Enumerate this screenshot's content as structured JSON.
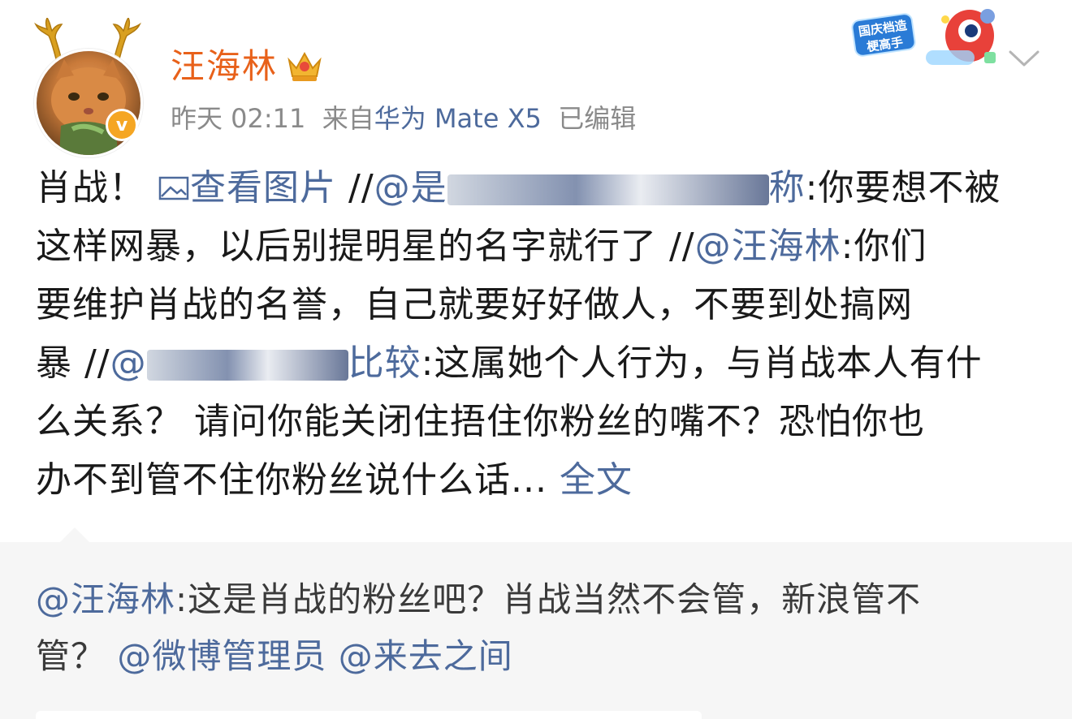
{
  "post": {
    "username": "汪海林",
    "time": "昨天 02:11",
    "source_prefix": "来自",
    "device": "华为 Mate X5",
    "edited": "已编辑",
    "verified_mark": "v",
    "event_badge_text": "国庆档造梗高手",
    "body": {
      "l1_a": "肖战！ ",
      "l1_img": "查看图片",
      "l1_b": " //",
      "l1_mention_start": "@是",
      "l1_mention_end": "称",
      "l1_c": ":你要想不被",
      "l2_a": "这样网暴，以后别提明星的名字就行了 //",
      "l2_mention": "@汪海林",
      "l2_b": ":你们",
      "l3": "要维护肖战的名誉，自己就要好好做人，不要到处搞网",
      "l4_a": "暴 //",
      "l4_mention_start": "@",
      "l4_mention_end": "比较",
      "l4_b": ":这属她个人行为，与肖战本人有什",
      "l5": "么关系？ 请问你能关闭住捂住你粉丝的嘴不？恐怕你也",
      "l6_a": "办不到管不住你粉丝说什么话... ",
      "l6_more": "全文"
    }
  },
  "repost": {
    "mention": "@汪海林",
    "text1": ":这是肖战的粉丝吧？肖战当然不会管，新浪管不",
    "text2": "管？ ",
    "mention2": "@微博管理员",
    "mention3": "@来去之间"
  },
  "colors": {
    "username": "#e8611a",
    "link": "#4d6a9c",
    "meta": "#8a8a8a",
    "verified": "#f5a623",
    "repost_bg": "#f6f6f6"
  }
}
